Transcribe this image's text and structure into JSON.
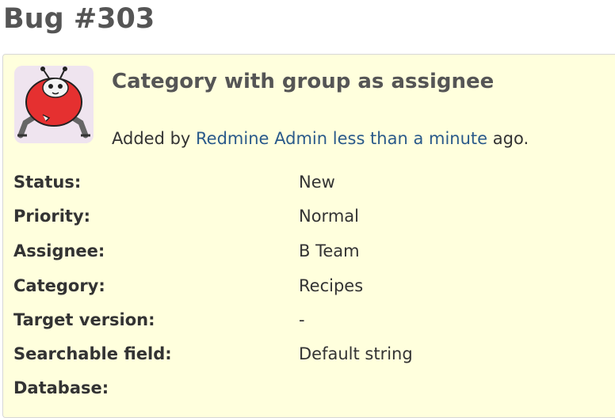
{
  "page": {
    "title": "Bug #303"
  },
  "issue": {
    "subject": "Category with group as assignee",
    "author_prefix": "Added by",
    "author_name": "Redmine Admin",
    "time_ago": "less than a minute",
    "author_suffix": "ago.",
    "avatar_icon": "bug-mascot-avatar"
  },
  "attributes": [
    {
      "label": "Status:",
      "value": "New"
    },
    {
      "label": "Priority:",
      "value": "Normal"
    },
    {
      "label": "Assignee:",
      "value": "B Team"
    },
    {
      "label": "Category:",
      "value": "Recipes"
    },
    {
      "label": "Target version:",
      "value": "-"
    },
    {
      "label": "Searchable field:",
      "value": "Default string"
    },
    {
      "label": "Database:",
      "value": ""
    }
  ],
  "colors": {
    "box_background": "#ffffdd",
    "link": "#2a5a8a",
    "title": "#555555"
  }
}
